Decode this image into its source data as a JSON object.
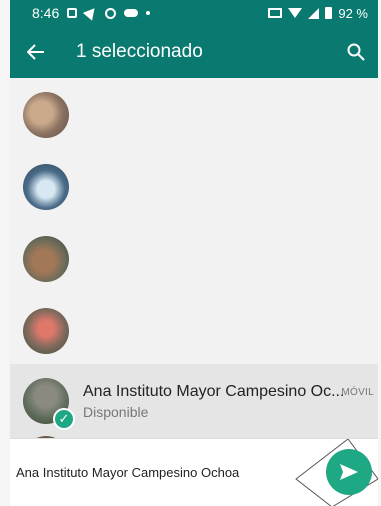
{
  "status_bar": {
    "time": "8:46",
    "battery_text": "92 %",
    "icons": [
      "document-icon",
      "send-icon",
      "whatsapp-icon",
      "cloud-icon",
      "dot-icon",
      "cast-icon",
      "wifi-icon",
      "signal-icon",
      "battery-icon"
    ]
  },
  "app_bar": {
    "back_icon": "arrow-left-icon",
    "title": "1 seleccionado",
    "search_icon": "search-icon"
  },
  "contacts": [
    {
      "name": "",
      "status": "",
      "type": "",
      "selected": false
    },
    {
      "name": "",
      "status": "",
      "type": "",
      "selected": false
    },
    {
      "name": "",
      "status": "",
      "type": "",
      "selected": false
    },
    {
      "name": "",
      "status": "",
      "type": "",
      "selected": false
    },
    {
      "name": "Ana Instituto Mayor Campesino Oc...",
      "status": "Disponible",
      "type": "MÓVIL",
      "selected": true
    }
  ],
  "bottom_bar": {
    "selected_label": "Ana Instituto Mayor Campesino Ochoa",
    "send_icon": "send-icon"
  },
  "colors": {
    "primary": "#0a7a70",
    "accent": "#1fa884"
  }
}
